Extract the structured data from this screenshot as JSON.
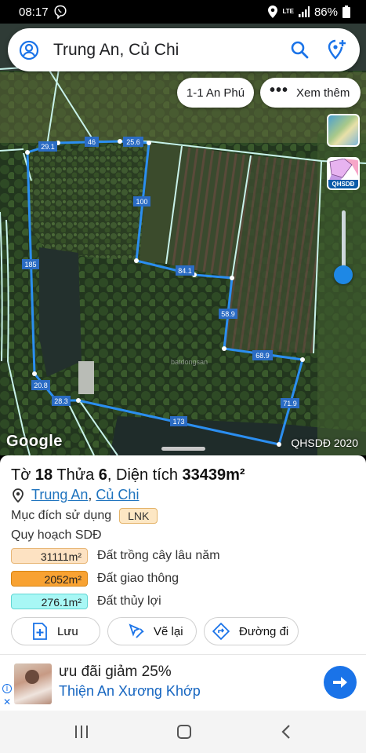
{
  "status_bar": {
    "time": "08:17",
    "network_label": "LTE",
    "battery": "86%"
  },
  "search": {
    "query": "Trung An, Củ Chi"
  },
  "chips": {
    "area": "1-1 An Phú",
    "more_label": "Xem thêm",
    "more_dots": "•••"
  },
  "layers": {
    "planning_layer_label": "QHSDĐ"
  },
  "map": {
    "attribution": "Google",
    "badge": "QHSDĐ 2020",
    "watermark": "batdongsan",
    "edge_labels": [
      "29.1",
      "46",
      "25.6",
      "100",
      "185",
      "84.1",
      "58.9",
      "68.9",
      "20.8",
      "28.3",
      "71.9",
      "173"
    ]
  },
  "parcel": {
    "sheet_prefix": "Tờ",
    "sheet_no": "18",
    "parcel_prefix": "Thửa",
    "parcel_no": "6",
    "area_label": ", Diện tích",
    "area_value": "33439m²",
    "ward": "Trung An",
    "address_sep": ",",
    "district": "Củ Chi",
    "purpose_label": "Mục đích sử dụng",
    "purpose_code": "LNK",
    "plan_title": "Quy hoạch SDĐ",
    "zones": [
      {
        "area": "31111m²",
        "label": "Đất trồng cây lâu năm",
        "color": "#fde2c2"
      },
      {
        "area": "2052m²",
        "label": "Đất giao thông",
        "color": "#f8a232"
      },
      {
        "area": "276.1m²",
        "label": "Đất thủy lợi",
        "color": "#a8f7f5"
      }
    ]
  },
  "actions": {
    "save": "Lưu",
    "redraw": "Vẽ lại",
    "route": "Đường đi"
  },
  "ad": {
    "title": "ưu đãi giảm 25%",
    "subtitle": "Thiện An Xương Khớp",
    "info": "i",
    "close": "✕"
  },
  "colors": {
    "accent": "#1a73e8",
    "parcel_line": "#2b8ef0",
    "planning_line": "#c8f2ea"
  }
}
